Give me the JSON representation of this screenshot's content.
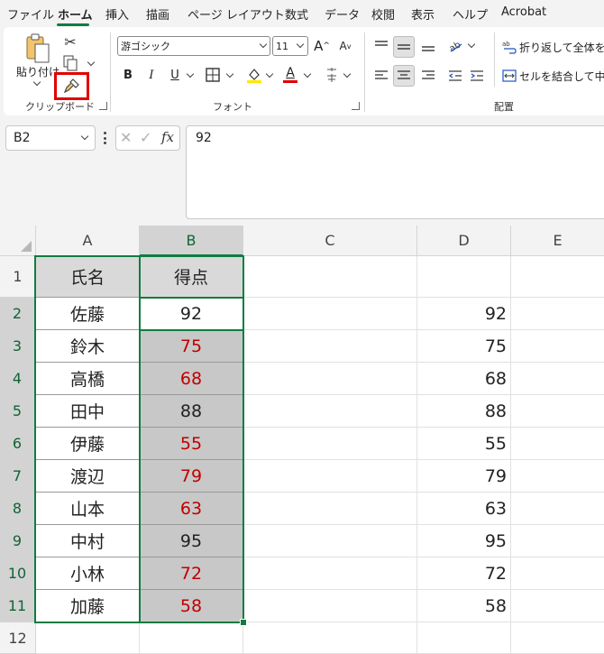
{
  "menu": [
    "ファイル",
    "ホーム",
    "挿入",
    "描画",
    "ページ レイアウト",
    "数式",
    "データ",
    "校閲",
    "表示",
    "ヘルプ",
    "Acrobat"
  ],
  "ribbon": {
    "paste_label": "貼り付け",
    "clipboard_label": "クリップボード",
    "font_label": "フォント",
    "align_label": "配置",
    "font_name": "游ゴシック",
    "font_size": "11",
    "bold": "B",
    "italic": "I",
    "underline": "U",
    "grow_font": "A",
    "shrink_font": "A",
    "font_color_letter": "A",
    "wrap_text": "折り返して全体を表",
    "merge_center": "セルを結合して中央"
  },
  "formula_bar": {
    "name_box": "B2",
    "fx": "fx",
    "content": "92"
  },
  "columns": [
    "A",
    "B",
    "C",
    "D",
    "E"
  ],
  "rows": [
    "1",
    "2",
    "3",
    "4",
    "5",
    "6",
    "7",
    "8",
    "9",
    "10",
    "11",
    "12"
  ],
  "headers": {
    "name": "氏名",
    "score": "得点"
  },
  "names": [
    "佐藤",
    "鈴木",
    "高橋",
    "田中",
    "伊藤",
    "渡辺",
    "山本",
    "中村",
    "小林",
    "加藤"
  ],
  "scores": [
    "92",
    "75",
    "68",
    "88",
    "55",
    "79",
    "63",
    "95",
    "72",
    "58"
  ],
  "colors": {
    "accent": "#107c41",
    "low_score": "#c00000",
    "highlight_box": "#e00000"
  }
}
